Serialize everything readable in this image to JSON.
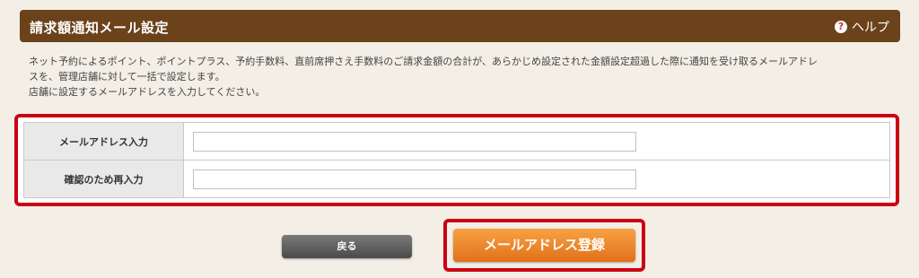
{
  "header": {
    "title": "請求額通知メール設定",
    "help_label": "ヘルプ",
    "help_icon": "question-circle-icon"
  },
  "description": {
    "line1": "ネット予約によるポイント、ポイントプラス、予約手数料、直前席押さえ手数料のご請求金額の合計が、あらかじめ設定された金額設定超過した際に通知を受け取るメールアドレ",
    "line2": "スを、管理店舗に対して一括で設定します。",
    "line3": "店舗に設定するメールアドレスを入力してください。"
  },
  "form": {
    "rows": [
      {
        "label": "メールアドレス入力",
        "value": ""
      },
      {
        "label": "確認のため再入力",
        "value": ""
      }
    ]
  },
  "buttons": {
    "back_label": "戻る",
    "submit_label": "メールアドレス登録"
  },
  "colors": {
    "header_bg": "#6b421a",
    "highlight_border": "#cc0014",
    "submit_bg": "#e2701a",
    "back_bg": "#4a4a4a",
    "page_bg": "#f3efe6"
  }
}
